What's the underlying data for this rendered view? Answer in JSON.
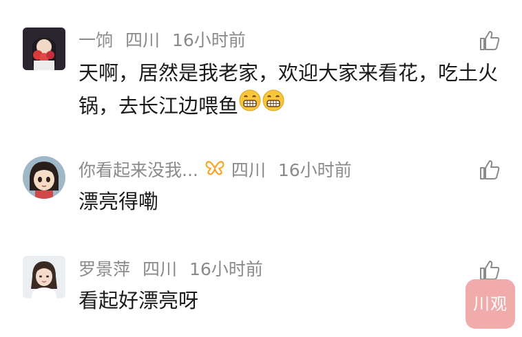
{
  "comments": [
    {
      "username": "一饷",
      "location": "四川",
      "time": "16小时前",
      "content": "天啊，居然是我老家，欢迎大家来看花，吃土火锅，去长江边喂鱼",
      "emoji": "grinning-face-emoji",
      "avatar": "avatar-woman-flowers"
    },
    {
      "username": "你看起来没我...",
      "location": "四川",
      "time": "16小时前",
      "content": "漂亮得嘞",
      "badge": "orange-butterfly-badge",
      "avatar": "avatar-anime-girl"
    },
    {
      "username": "罗景萍",
      "location": "四川",
      "time": "16小时前",
      "content": "看起好漂亮呀",
      "avatar": "avatar-woman-portrait"
    }
  ],
  "watermark": {
    "text": "川观"
  },
  "icons": {
    "like": "thumbs-up-icon"
  },
  "colors": {
    "meta_text": "#8a8a8a",
    "content_text": "#1a1a1a",
    "badge": "#f5a623",
    "watermark_bg": "#f0a3a3"
  }
}
